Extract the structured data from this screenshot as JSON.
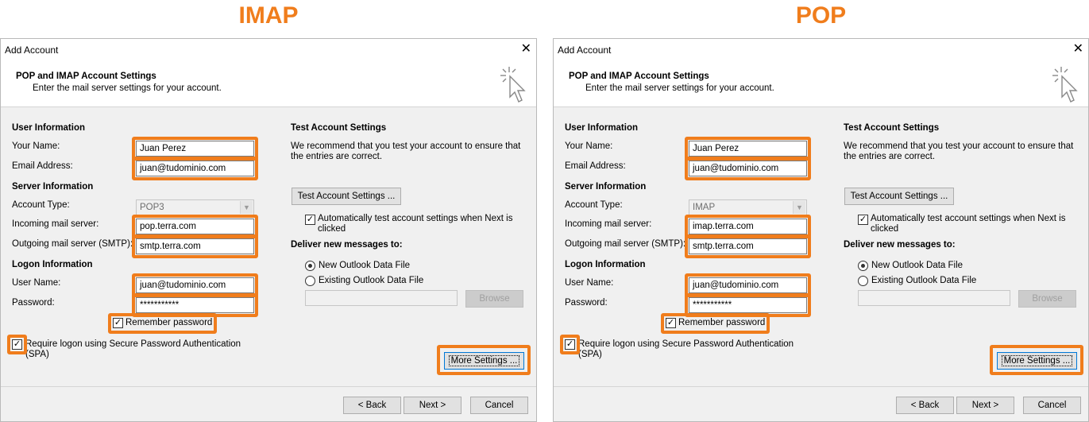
{
  "panels": [
    {
      "heading": "IMAP",
      "title": "Add Account",
      "close": "✕",
      "header_title": "POP and IMAP Account Settings",
      "header_sub": "Enter the mail server settings for your account.",
      "user_info": "User Information",
      "your_name_label": "Your Name:",
      "your_name": "Juan Perez",
      "email_label": "Email Address:",
      "email": "juan@tudominio.com",
      "server_info": "Server Information",
      "account_type_label": "Account Type:",
      "account_type": "POP3",
      "incoming_label": "Incoming mail server:",
      "incoming": "pop.terra.com",
      "outgoing_label": "Outgoing mail server (SMTP):",
      "outgoing": "smtp.terra.com",
      "logon_info": "Logon Information",
      "username_label": "User Name:",
      "username": "juan@tudominio.com",
      "password_label": "Password:",
      "password": "***********",
      "remember": "Remember password",
      "spa": "Require logon using Secure Password Authentication (SPA)",
      "test_title": "Test Account Settings",
      "test_desc": "We recommend that you test your account to ensure that the entries are correct.",
      "test_btn": "Test Account Settings ...",
      "auto_test": "Automatically test account settings when Next is clicked",
      "deliver": "Deliver new messages to:",
      "new_file": "New Outlook Data File",
      "existing_file": "Existing Outlook Data File",
      "browse": "Browse",
      "more": "More Settings ...",
      "back": "< Back",
      "next": "Next >",
      "cancel": "Cancel"
    },
    {
      "heading": "POP",
      "title": "Add Account",
      "close": "✕",
      "header_title": "POP and IMAP Account Settings",
      "header_sub": "Enter the mail server settings for your account.",
      "user_info": "User Information",
      "your_name_label": "Your Name:",
      "your_name": "Juan Perez",
      "email_label": "Email Address:",
      "email": "juan@tudominio.com",
      "server_info": "Server Information",
      "account_type_label": "Account Type:",
      "account_type": "IMAP",
      "incoming_label": "Incoming mail server:",
      "incoming": "imap.terra.com",
      "outgoing_label": "Outgoing mail server (SMTP):",
      "outgoing": "smtp.terra.com",
      "logon_info": "Logon Information",
      "username_label": "User Name:",
      "username": "juan@tudominio.com",
      "password_label": "Password:",
      "password": "***********",
      "remember": "Remember password",
      "spa": "Require logon using Secure Password Authentication (SPA)",
      "test_title": "Test Account Settings",
      "test_desc": "We recommend that you test your account to ensure that the entries are correct.",
      "test_btn": "Test Account Settings ...",
      "auto_test": "Automatically test account settings when Next is clicked",
      "deliver": "Deliver new messages to:",
      "new_file": "New Outlook Data File",
      "existing_file": "Existing Outlook Data File",
      "browse": "Browse",
      "more": "More Settings ...",
      "back": "< Back",
      "next": "Next >",
      "cancel": "Cancel"
    }
  ],
  "colors": {
    "highlight": "#f07d1c",
    "dialog_bg": "#f0f0f0"
  }
}
